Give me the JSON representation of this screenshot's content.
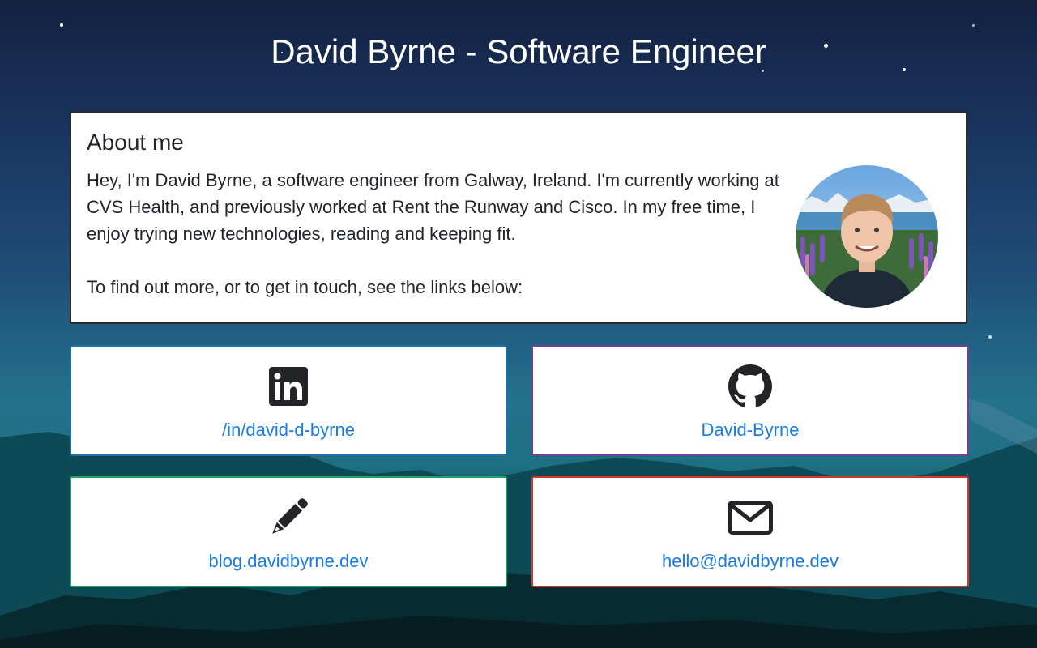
{
  "header": {
    "title": "David Byrne - Software Engineer"
  },
  "about": {
    "heading": "About me",
    "paragraph1": "Hey, I'm David Byrne, a software engineer from Galway, Ireland. I'm currently working at CVS Health, and previously worked at Rent the Runway and Cisco. In my free time, I enjoy trying new technologies, reading and keeping fit.",
    "paragraph2": "To find out more, or to get in touch, see the links below:"
  },
  "links": [
    {
      "icon": "linkedin-icon",
      "label": "/in/david-d-byrne",
      "border_color": "#1f6fa8"
    },
    {
      "icon": "github-icon",
      "label": "David-Byrne",
      "border_color": "#6f3f99"
    },
    {
      "icon": "pencil-icon",
      "label": "blog.davidbyrne.dev",
      "border_color": "#27a067"
    },
    {
      "icon": "envelope-icon",
      "label": "hello@davidbyrne.dev",
      "border_color": "#cf3b2e"
    }
  ],
  "colors": {
    "link_text": "#1a7be0",
    "icon": "#222428",
    "text": "#212529"
  }
}
